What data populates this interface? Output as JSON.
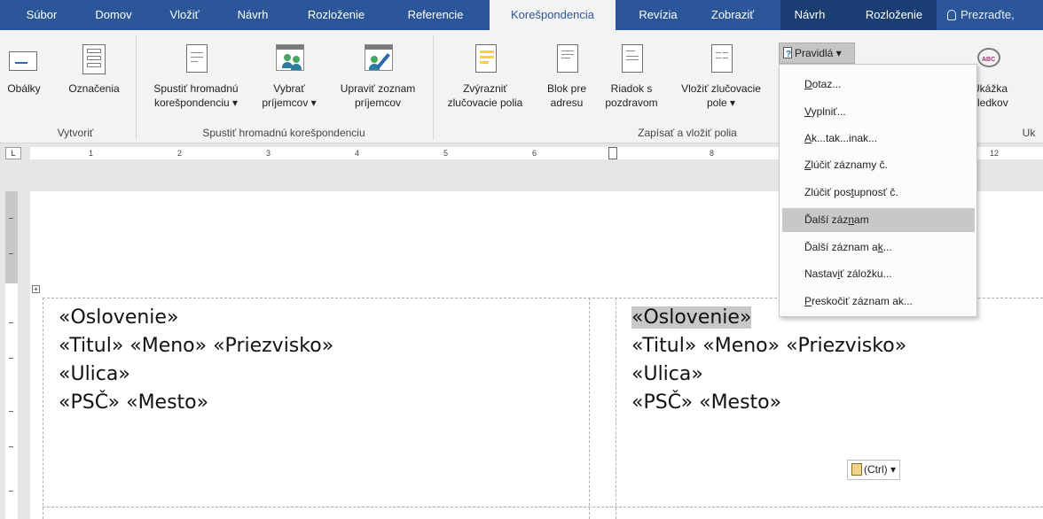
{
  "tabs": [
    "Súbor",
    "Domov",
    "Vložiť",
    "Návrh",
    "Rozloženie",
    "Referencie",
    "Korešpondencia",
    "Revízia",
    "Zobraziť",
    "Návrh",
    "Rozloženie"
  ],
  "tell_me": "Prezraďte,",
  "ribbon": {
    "obalky": "Obálky",
    "oznacenia": "Označenia",
    "group_vytvorit": "Vytvoriť",
    "spustit_1": "Spustiť hromadnú",
    "spustit_2": "korešpondenciu ▾",
    "vybrat_1": "Vybrať",
    "vybrat_2": "príjemcov ▾",
    "upravit_1": "Upraviť zoznam",
    "upravit_2": "príjemcov",
    "group_spustit": "Spustiť hromadnú korešpondenciu",
    "zvyraznit_1": "Zvýrazniť",
    "zvyraznit_2": "zlučovacie polia",
    "blok_1": "Blok pre",
    "blok_2": "adresu",
    "riadok_1": "Riadok s",
    "riadok_2": "pozdravom",
    "vlozit_1": "Vložiť zlučovacie",
    "vlozit_2": "pole ▾",
    "group_zapisat": "Zapísať a vložiť polia",
    "pravidla": "Pravidlá ▾",
    "ukazka_1": "Ukážka",
    "ukazka_2": "sledkov",
    "group_uk": "Uk"
  },
  "ruler_ticks": [
    "1",
    "2",
    "3",
    "4",
    "5",
    "6",
    "8",
    "12"
  ],
  "menu": {
    "items": [
      {
        "pre": "",
        "u": "D",
        "post": "otaz..."
      },
      {
        "pre": "",
        "u": "V",
        "post": "yplniť..."
      },
      {
        "pre": "",
        "u": "A",
        "post": "k...tak...inak..."
      },
      {
        "pre": "",
        "u": "Z",
        "post": "lúčiť záznamy č."
      },
      {
        "pre": "Zlúčiť pos",
        "u": "t",
        "post": "upnosť č."
      },
      {
        "pre": "Ďalší záz",
        "u": "n",
        "post": "am"
      },
      {
        "pre": "Ďalší záznam a",
        "u": "k",
        "post": "..."
      },
      {
        "pre": "Nastav",
        "u": "i",
        "post": "ť záložku..."
      },
      {
        "pre": "",
        "u": "P",
        "post": "reskočiť záznam ak..."
      }
    ],
    "highlighted_index": 5
  },
  "document": {
    "left": [
      "«Oslovenie»",
      "«Titul» «Meno» «Priezvisko»",
      "«Ulica»",
      "«PSČ» «Mesto»"
    ],
    "right_first": "«Oslovenie»",
    "right": [
      "«Titul» «Meno» «Priezvisko»",
      "«Ulica»",
      "«PSČ» «Mesto»"
    ]
  },
  "paste_tag": "(Ctrl) ▾"
}
